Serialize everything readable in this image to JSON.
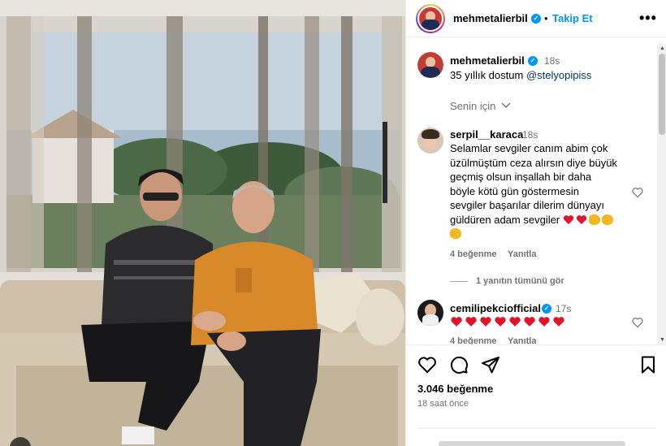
{
  "post": {
    "author": "mehmetalierbil",
    "follow_label": "Takip Et",
    "more_label": "•••",
    "separator": "•",
    "caption_time": "18s",
    "caption_text": "35 yıllık dostum",
    "caption_mention": "@stelyopipiss",
    "sort_label": "Senin için",
    "likes": "3.046 beğenme",
    "posted_ago": "18 saat önce"
  },
  "comments": [
    {
      "username": "serpil__karaca",
      "time": "18s",
      "lines": [
        "Selamlar sevgiler canım abim çok",
        "üzülmüştüm ceza alırsın diye büyük",
        "geçmiş olsun inşallah bir daha",
        "böyle kötü gün göstermesin",
        "sevgiler başarılar dilerim dünyayı",
        "güldüren adam sevgiler"
      ],
      "likes": "4 beğenme",
      "reply_label": "Yanıtla",
      "view_replies": "1 yanıtın tümünü gör"
    },
    {
      "username": "cemilipekciofficial",
      "time": "17s",
      "likes": "4 beğenme",
      "reply_label": "Yanıtla",
      "heart_count": 8
    }
  ],
  "icons": {
    "like": "heart-icon",
    "comment": "comment-icon",
    "share": "share-icon",
    "save": "bookmark-icon",
    "verified": "verified-badge-icon",
    "chevron": "chevron-down-icon"
  },
  "colors": {
    "link": "#0095f6",
    "mention": "#00376b",
    "muted": "#737373",
    "heart_emoji": "#e0142a"
  }
}
